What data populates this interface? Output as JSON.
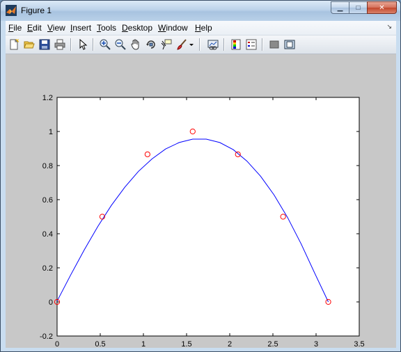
{
  "window": {
    "title": "Figure 1",
    "icons": {
      "app": "matlab-logo-icon",
      "minimize": "minimize-icon",
      "maximize": "maximize-icon",
      "close": "close-icon"
    }
  },
  "menubar": {
    "items": [
      {
        "pre": "",
        "key": "F",
        "post": "ile"
      },
      {
        "pre": "",
        "key": "E",
        "post": "dit"
      },
      {
        "pre": "",
        "key": "V",
        "post": "iew"
      },
      {
        "pre": "",
        "key": "I",
        "post": "nsert"
      },
      {
        "pre": "",
        "key": "T",
        "post": "ools"
      },
      {
        "pre": "",
        "key": "D",
        "post": "esktop"
      },
      {
        "pre": "",
        "key": "W",
        "post": "indow"
      },
      {
        "pre": "",
        "key": "H",
        "post": "elp"
      }
    ],
    "dock_icon": "dock-arrow-icon"
  },
  "toolbar": {
    "buttons": [
      "new-figure-icon",
      "open-file-icon",
      "save-icon",
      "print-icon",
      "edit-plot-arrow-icon",
      "zoom-in-icon",
      "zoom-out-icon",
      "pan-hand-icon",
      "rotate-3d-icon",
      "data-cursor-icon",
      "brush-icon",
      "brush-dropdown-icon",
      "link-plot-icon",
      "colorbar-icon",
      "legend-icon",
      "hide-plot-tools-icon",
      "show-plot-tools-icon"
    ]
  },
  "chart_data": {
    "type": "line",
    "title": "",
    "xlabel": "",
    "ylabel": "",
    "xlim": [
      0,
      3.5
    ],
    "ylim": [
      -0.2,
      1.2
    ],
    "xticks": [
      "0",
      "0.5",
      "1",
      "1.5",
      "2",
      "2.5",
      "3",
      "3.5"
    ],
    "yticks": [
      "-0.2",
      "0",
      "0.2",
      "0.4",
      "0.6",
      "0.8",
      "1",
      "1.2"
    ],
    "grid": false,
    "series": [
      {
        "style": "line",
        "color": "#0000ff",
        "x": [
          0,
          0.1571,
          0.3142,
          0.4712,
          0.6283,
          0.7854,
          0.9425,
          1.0996,
          1.2566,
          1.4137,
          1.5708,
          1.7279,
          1.885,
          2.042,
          2.1991,
          2.3562,
          2.5133,
          2.6704,
          2.8274,
          2.9845,
          3.1416
        ],
        "y": [
          0.005,
          0.158,
          0.305,
          0.442,
          0.566,
          0.674,
          0.766,
          0.839,
          0.897,
          0.935,
          0.955,
          0.955,
          0.935,
          0.893,
          0.826,
          0.738,
          0.628,
          0.495,
          0.34,
          0.168,
          0.0
        ]
      },
      {
        "style": "markers",
        "marker": "circle",
        "color": "#ff0000",
        "x": [
          0,
          0.5236,
          1.0472,
          1.5708,
          2.0944,
          2.618,
          3.1416
        ],
        "y": [
          0,
          0.5,
          0.866,
          1.0,
          0.866,
          0.5,
          0
        ]
      }
    ]
  }
}
